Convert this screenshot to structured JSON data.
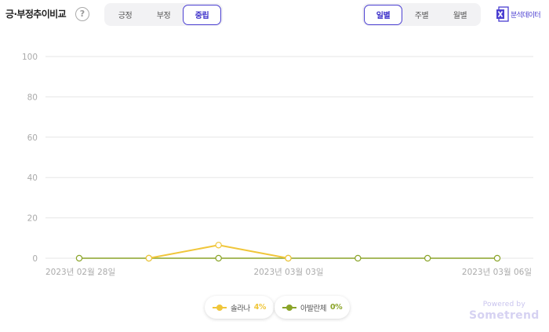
{
  "header": {
    "title": "긍·부정추이비교",
    "help_glyph": "?",
    "sentiment_tabs": [
      {
        "label": "긍정",
        "active": false
      },
      {
        "label": "부정",
        "active": false
      },
      {
        "label": "중립",
        "active": true
      }
    ],
    "period_tabs": [
      {
        "label": "일별",
        "active": true
      },
      {
        "label": "주별",
        "active": false
      },
      {
        "label": "월별",
        "active": false
      }
    ],
    "export_label": "분석데이터",
    "export_icon": "excel-icon"
  },
  "colors": {
    "accent": "#4b3fd1",
    "series_1": "#f0c63a",
    "series_2": "#8aa428",
    "grid": "#e6e6e6"
  },
  "chart_data": {
    "type": "line",
    "ylim": [
      0,
      100
    ],
    "y_ticks": [
      "0",
      "20",
      "40",
      "60",
      "80",
      "100"
    ],
    "x_tick_labels": [
      "2023년 02월 28일",
      "2023년 03월 03일",
      "2023년 03월 06일"
    ],
    "x": [
      "2023-02-28",
      "2023-03-01",
      "2023-03-02",
      "2023-03-03",
      "2023-03-04",
      "2023-03-05",
      "2023-03-06"
    ],
    "grid": true,
    "series": [
      {
        "name": "솔라나",
        "color": "#f0c63a",
        "values": [
          null,
          0,
          6.5,
          0,
          null,
          null,
          null
        ]
      },
      {
        "name": "아발란체",
        "color": "#8aa428",
        "values": [
          0,
          0,
          0,
          0,
          0,
          0,
          0
        ]
      }
    ]
  },
  "legend": [
    {
      "name": "솔라나",
      "pct": "4%"
    },
    {
      "name": "아발란체",
      "pct": "0%"
    }
  ],
  "footer": {
    "powered_by": "Powered by",
    "brand": "Sometrend"
  }
}
